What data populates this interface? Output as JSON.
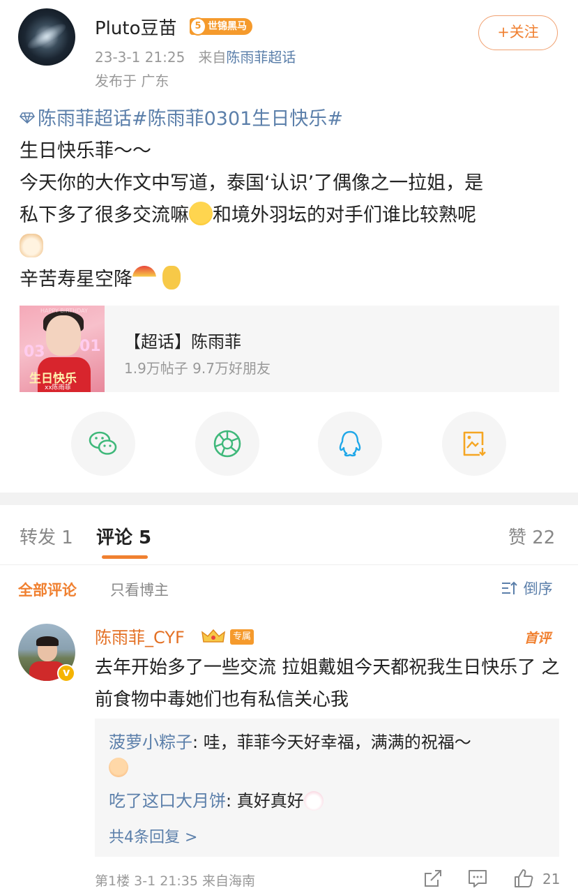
{
  "post": {
    "username": "Pluto豆苗",
    "rank_number": "5",
    "rank_badge": "世锦黑马",
    "timestamp": "23-3-1 21:25",
    "source_prefix": "来自",
    "source": "陈雨菲超话",
    "location": "发布于 广东",
    "follow_label": "+关注",
    "topic_line": "陈雨菲超话#陈雨菲0301生日快乐#",
    "text_line1": "生日快乐菲～～",
    "text_line2": "今天你的大作文中写道，泰国‘认识’了偶像之一拉姐，是",
    "text_line3a": "私下多了很多交流嘛",
    "text_line3b": "和境外羽坛的对手们谁比较熟呢",
    "text_line5": "辛苦寿星空降"
  },
  "chaohua_card": {
    "thumb_top": "HAPPY BIRTHDAY",
    "thumb_left": "03",
    "thumb_right": "01",
    "thumb_caption": "生日快乐",
    "thumb_sign": "xx陈雨菲",
    "title": "【超话】陈雨菲",
    "stats": "1.9万帖子 9.7万好朋友"
  },
  "share": {
    "icons": [
      "wechat-icon",
      "moments-icon",
      "qq-icon",
      "save-image-icon"
    ]
  },
  "tabs": {
    "repost": "转发 1",
    "comment": "评论 5",
    "like": "赞 22"
  },
  "filters": {
    "all": "全部评论",
    "host_only": "只看博主",
    "sort": "倒序"
  },
  "comment": {
    "name": "陈雨菲_CYF",
    "exclusive_badge": "专属",
    "first_badge": "首评",
    "text": "去年开始多了一些交流 拉姐戴姐今天都祝我生日快乐了 之前食物中毒她们也有私信关心我",
    "replies": [
      {
        "name": "菠萝小粽子",
        "sep": ": ",
        "text": "哇，菲菲今天好幸福，满满的祝福～"
      },
      {
        "name": "吃了这口大月饼",
        "sep": ": ",
        "text": "真好真好"
      }
    ],
    "more_replies": "共4条回复 >",
    "footer": "第1楼 3-1 21:35 来自海南",
    "like_count": "21"
  },
  "colors": {
    "accent": "#f08030",
    "link": "#5b7faa",
    "badge": "#f59a2c"
  }
}
